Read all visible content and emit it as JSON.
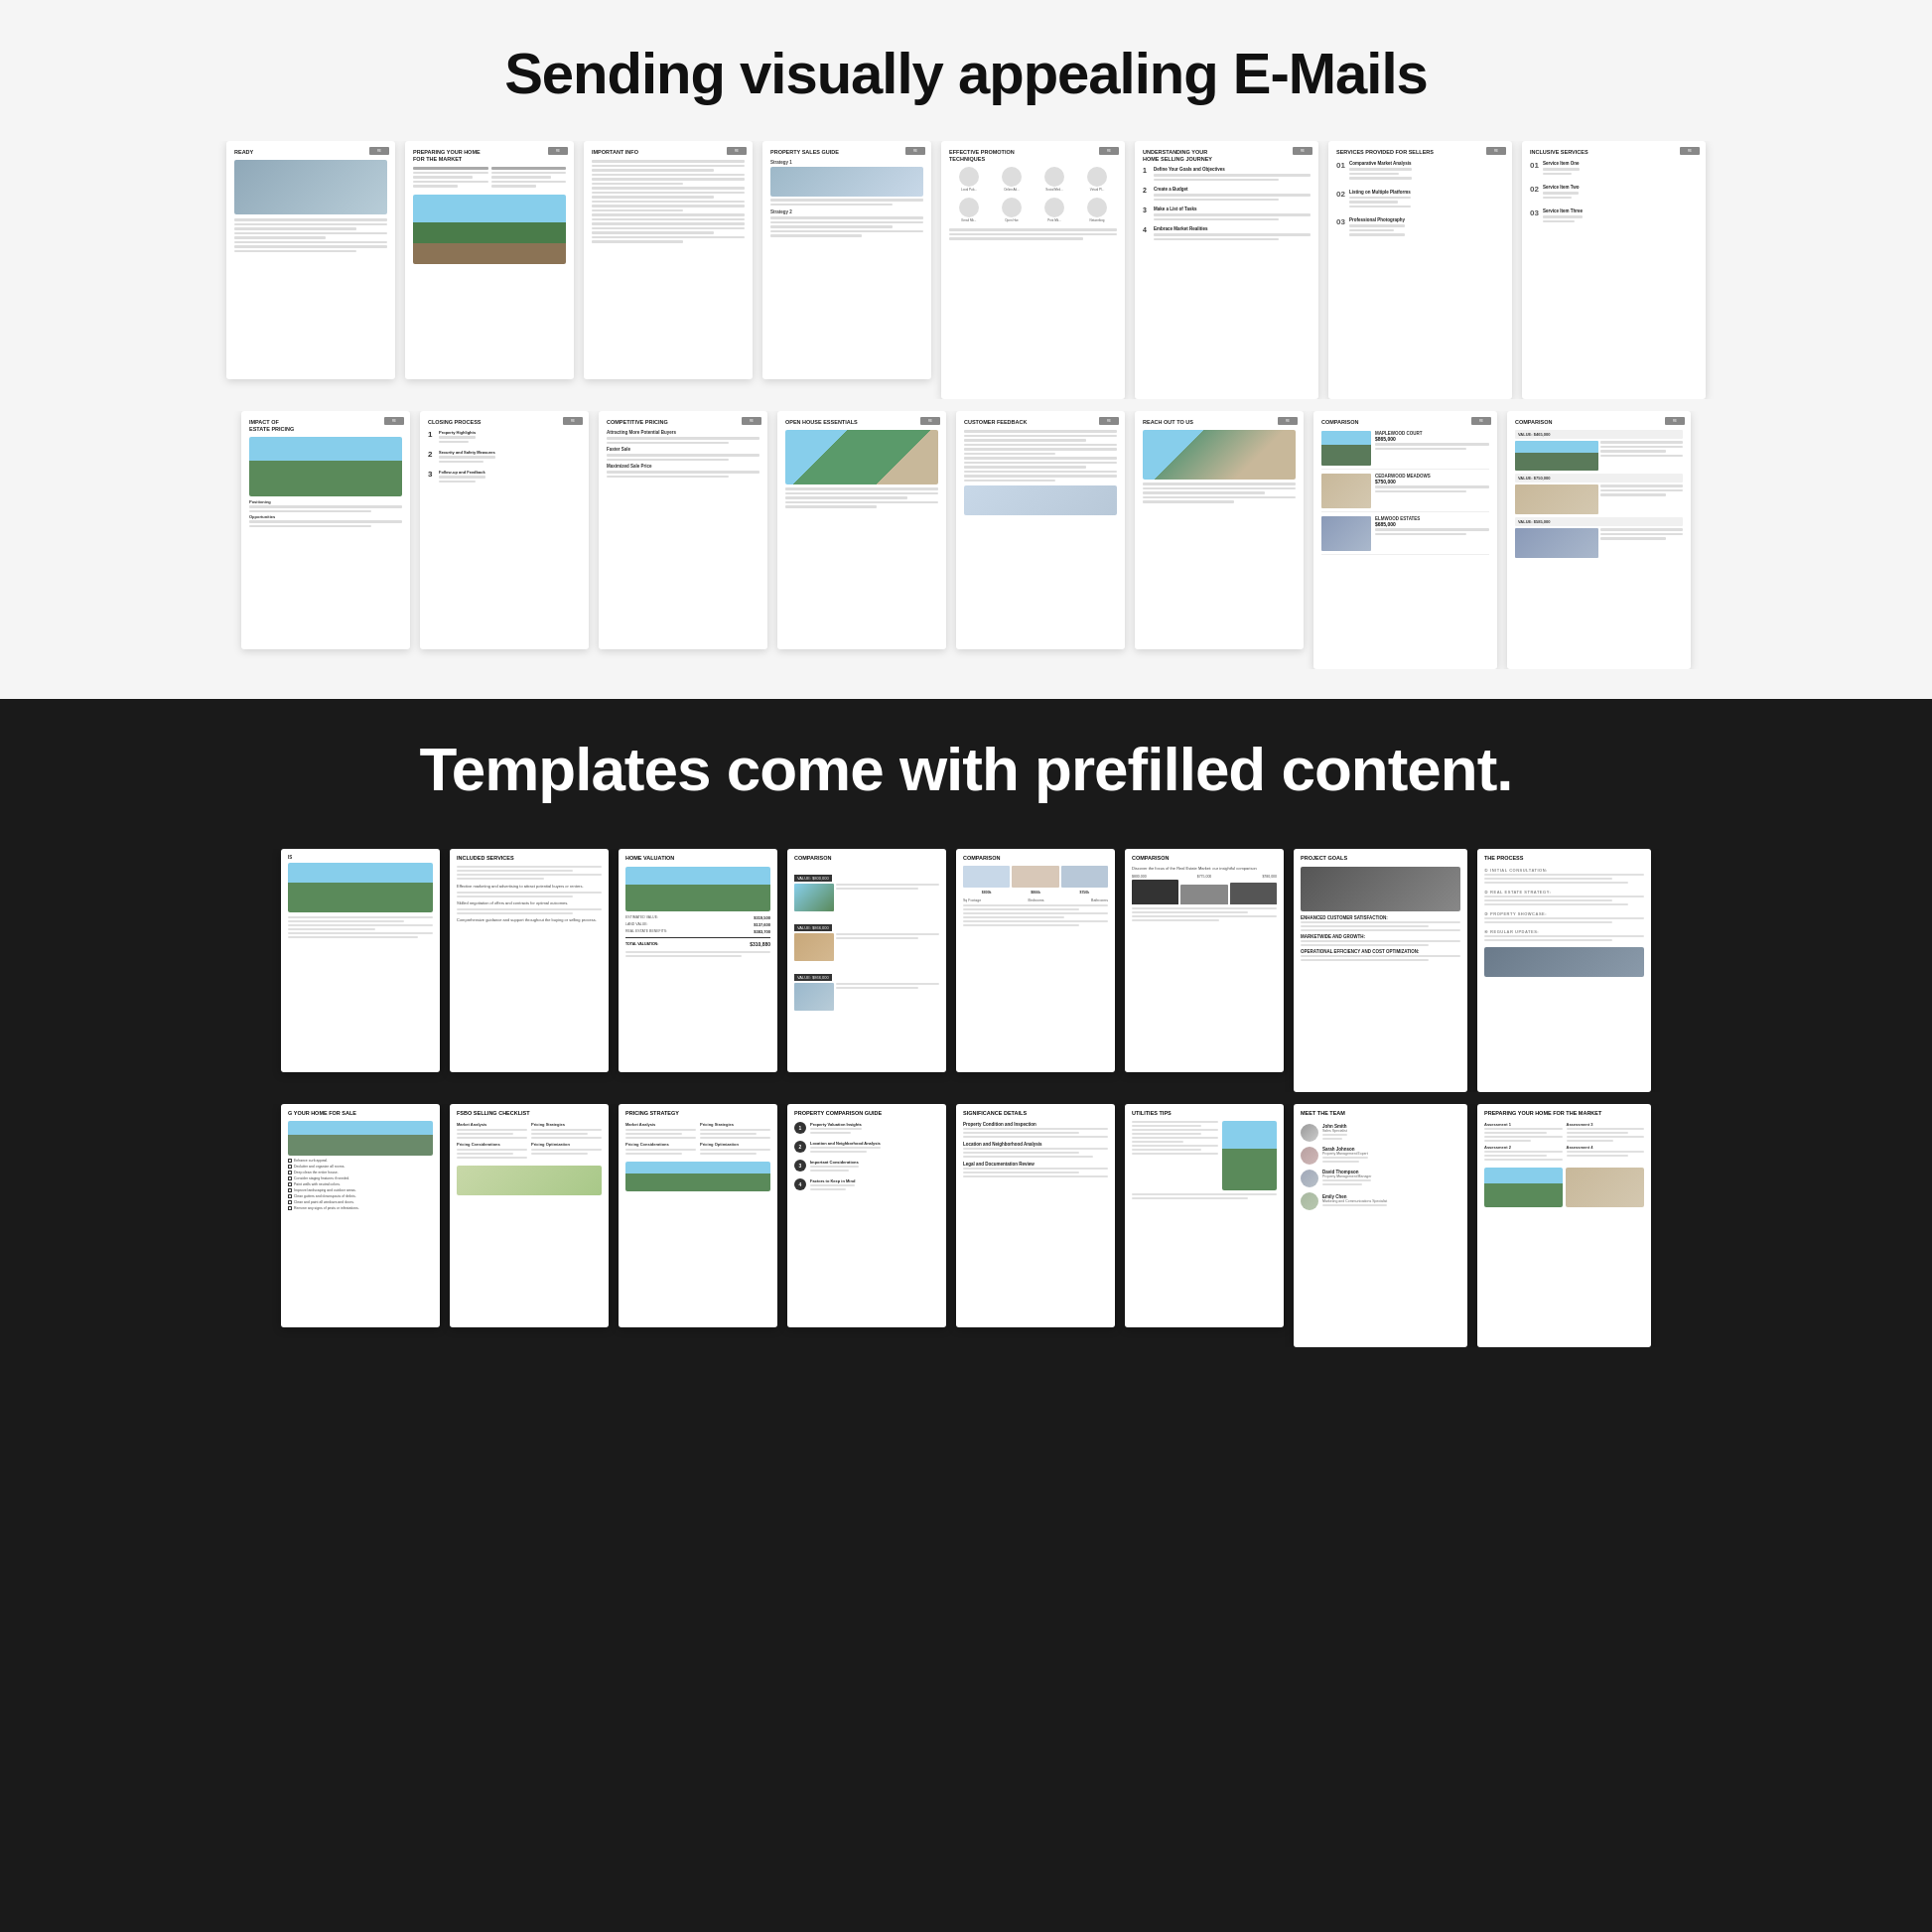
{
  "header": {
    "title": "Sending visually appealing E-Mails"
  },
  "middle": {
    "title": "Templates come with prefilled content."
  },
  "row1": {
    "cards": [
      {
        "id": "ready",
        "title": "READY",
        "type": "text-heavy",
        "hasImage": true
      },
      {
        "id": "preparing-market",
        "title": "PREPARING YOUR HOME FOR THE MARKET",
        "type": "two-col-text"
      },
      {
        "id": "important-info",
        "title": "IMPORTANT INFO",
        "type": "text-heavy"
      },
      {
        "id": "property-sales-guide",
        "title": "PROPERTY SALES GUIDE",
        "type": "mixed"
      },
      {
        "id": "effective-promotion",
        "title": "EFFECTIVE PROMOTION TECHNIQUES",
        "type": "icon-grid"
      },
      {
        "id": "understanding-journey",
        "title": "UNDERSTANDING YOUR HOME SELLING JOURNEY",
        "type": "steps"
      },
      {
        "id": "services-sellers",
        "title": "SERVICES PROVIDED FOR SELLERS",
        "type": "numbered"
      },
      {
        "id": "inclusive-services",
        "title": "INCLUSIVE SERVICES",
        "type": "numbered"
      }
    ]
  },
  "row2": {
    "cards": [
      {
        "id": "impact-pricing",
        "title": "IMPACT OF ESTATE PRICING",
        "type": "image-text"
      },
      {
        "id": "closing-process",
        "title": "CLOSING PROCESS",
        "type": "steps"
      },
      {
        "id": "competitive-pricing",
        "title": "COMPETITIVE PRICING",
        "type": "mixed"
      },
      {
        "id": "open-house",
        "title": "OPEN HOUSE ESSENTIALS",
        "type": "image-text"
      },
      {
        "id": "customer-feedback",
        "title": "CUSTOMER FEEDBACK",
        "type": "text-heavy"
      },
      {
        "id": "reach-out",
        "title": "REACH OUT TO US",
        "type": "contact"
      },
      {
        "id": "comparison1",
        "title": "COMPARISON",
        "type": "comparison",
        "properties": [
          {
            "name": "MAPLEWOOD COURT",
            "value": "$865,000",
            "color": "#888"
          },
          {
            "name": "CEDARWOOD MEADOWS",
            "value": "$750,000",
            "color": "#888"
          },
          {
            "name": "ELMWOOD ESTATES",
            "value": "$685,000",
            "color": "#888"
          }
        ]
      },
      {
        "id": "comparison2",
        "title": "COMPARISON",
        "type": "comparison-table"
      }
    ]
  },
  "row3": {
    "cards": [
      {
        "id": "included-services-b",
        "title": "IS",
        "type": "partial"
      },
      {
        "id": "included-services",
        "title": "INCLUDED SERVICES",
        "type": "text-list"
      },
      {
        "id": "home-valuation",
        "title": "HOME VALUATION",
        "type": "valuation",
        "values": [
          {
            "label": "ESTIMATED VALUE:",
            "value": "$319,500"
          },
          {
            "label": "LAND VALUE:",
            "value": "$137,600"
          },
          {
            "label": "REAL ESTATE BENEFITS:",
            "value": "$383,700"
          },
          {
            "label": "TOTAL VALUATION:",
            "value": "$310,880"
          }
        ]
      },
      {
        "id": "comparison-b",
        "title": "COMPARISON",
        "type": "comp-images",
        "items": [
          {
            "value": "$800,000"
          },
          {
            "value": "$866,000"
          },
          {
            "value": "$866,000"
          }
        ]
      },
      {
        "id": "comparison-c",
        "title": "COMPARISON",
        "type": "comp-table"
      },
      {
        "id": "comparison-d",
        "title": "COMPARISON",
        "type": "comp-bars"
      },
      {
        "id": "project-goals",
        "title": "PROJECT GOALS",
        "type": "goals"
      },
      {
        "id": "the-process",
        "title": "THE PROCESS",
        "type": "process-steps"
      }
    ]
  },
  "row4": {
    "cards": [
      {
        "id": "selling-home",
        "title": "G YOUR HOME FOR SALE",
        "type": "checklist"
      },
      {
        "id": "fsbo-checklist",
        "title": "FSBO SELLING CHECKLIST",
        "type": "checklist2"
      },
      {
        "id": "pricing-strategy",
        "title": "PRICING STRATEGY",
        "type": "two-col"
      },
      {
        "id": "property-comparison",
        "title": "PROPERTY COMPARISON GUIDE",
        "type": "numbered4"
      },
      {
        "id": "significance",
        "title": "SIGNIFICANCE DETAILS",
        "type": "numbered-text"
      },
      {
        "id": "utilities-tips",
        "title": "UTILITIES TIPS",
        "type": "text-image"
      },
      {
        "id": "meet-team",
        "title": "MEET THE TEAM",
        "type": "team"
      },
      {
        "id": "preparing-market2",
        "title": "PREPARING YOUR HOME FOR THE MARKET",
        "type": "two-col-text2"
      }
    ]
  },
  "colors": {
    "accent": "#333333",
    "light_bg": "#f5f5f5",
    "dark_bg": "#1a1a1a",
    "card_bg": "#ffffff",
    "image_placeholder": "#c8d5e0",
    "text_primary": "#111111",
    "text_secondary": "#555555"
  }
}
